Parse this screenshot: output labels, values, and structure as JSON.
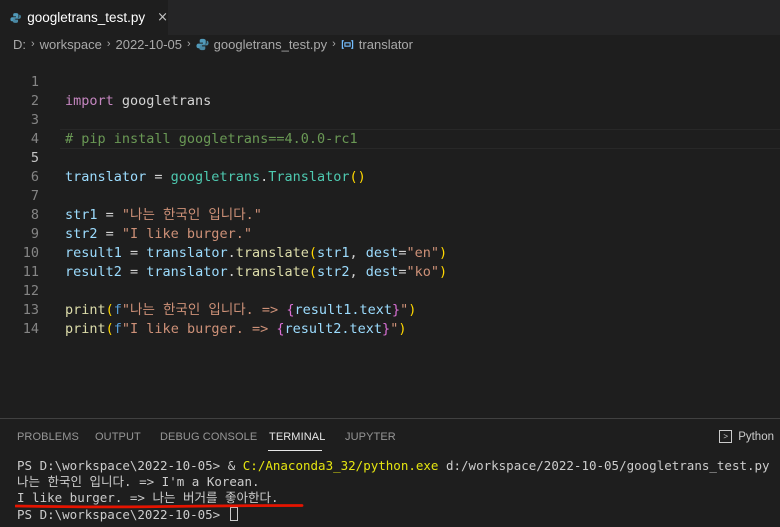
{
  "tab": {
    "label": "googletrans_test.py",
    "close": "×"
  },
  "breadcrumb": {
    "drive": "D:",
    "folder1": "workspace",
    "folder2": "2022-10-05",
    "file": "googletrans_test.py",
    "symbol": "translator",
    "sep": "›"
  },
  "editor": {
    "line_numbers": [
      "1",
      "2",
      "3",
      "4",
      "5",
      "6",
      "7",
      "8",
      "9",
      "10",
      "11",
      "12",
      "13",
      "14"
    ],
    "active_line": "5",
    "lines": {
      "l1": {
        "kw": "import",
        "mod": " googletrans"
      },
      "l3": {
        "comment": "# pip install googletrans==4.0.0-rc1"
      },
      "l5": {
        "var": "translator",
        "eq": " = ",
        "mod": "googletrans",
        "dot": ".",
        "cls": "Translator",
        "open": "(",
        "close": ")"
      },
      "l7": {
        "var": "str1",
        "eq": " = ",
        "str": "\"나는 한국인 입니다.\""
      },
      "l8": {
        "var": "str2",
        "eq": " = ",
        "str": "\"I like burger.\""
      },
      "l9": {
        "var": "result1",
        "eq": " = ",
        "obj": "translator",
        "dot": ".",
        "fn": "translate",
        "open": "(",
        "arg": "str1",
        "comma": ", ",
        "kwname": "dest",
        "kweq": "=",
        "kwval": "\"en\"",
        "close": ")"
      },
      "l10": {
        "var": "result2",
        "eq": " = ",
        "obj": "translator",
        "dot": ".",
        "fn": "translate",
        "open": "(",
        "arg": "str2",
        "comma": ", ",
        "kwname": "dest",
        "kweq": "=",
        "kwval": "\"ko\"",
        "close": ")"
      },
      "l12": {
        "fn": "print",
        "open": "(",
        "prefix": "f",
        "s1": "\"나는 한국인 입니다. => ",
        "bo": "{",
        "expr": "result1.text",
        "bc": "}",
        "s2": "\"",
        "close": ")"
      },
      "l13": {
        "fn": "print",
        "open": "(",
        "prefix": "f",
        "s1": "\"I like burger. => ",
        "bo": "{",
        "expr": "result2.text",
        "bc": "}",
        "s2": "\"",
        "close": ")"
      }
    }
  },
  "panel": {
    "tabs": [
      "PROBLEMS",
      "OUTPUT",
      "DEBUG CONSOLE",
      "TERMINAL",
      "JUPYTER"
    ],
    "active_tab": "TERMINAL",
    "terminal_kind": "Python"
  },
  "terminal": {
    "line1_prompt": "PS D:\\workspace\\2022-10-05> & ",
    "line1_exe": "C:/Anaconda3_32/python.exe",
    "line1_arg": " d:/workspace/2022-10-05/googletrans_test.py",
    "line2": "나는 한국인 입니다. => I'm a Korean.",
    "line3": "I like burger. => 나는 버거를 좋아한다.",
    "line4": "PS D:\\workspace\\2022-10-05> "
  },
  "colors": {
    "accent_underline": "#e51400",
    "python_icon": "#519aba"
  }
}
